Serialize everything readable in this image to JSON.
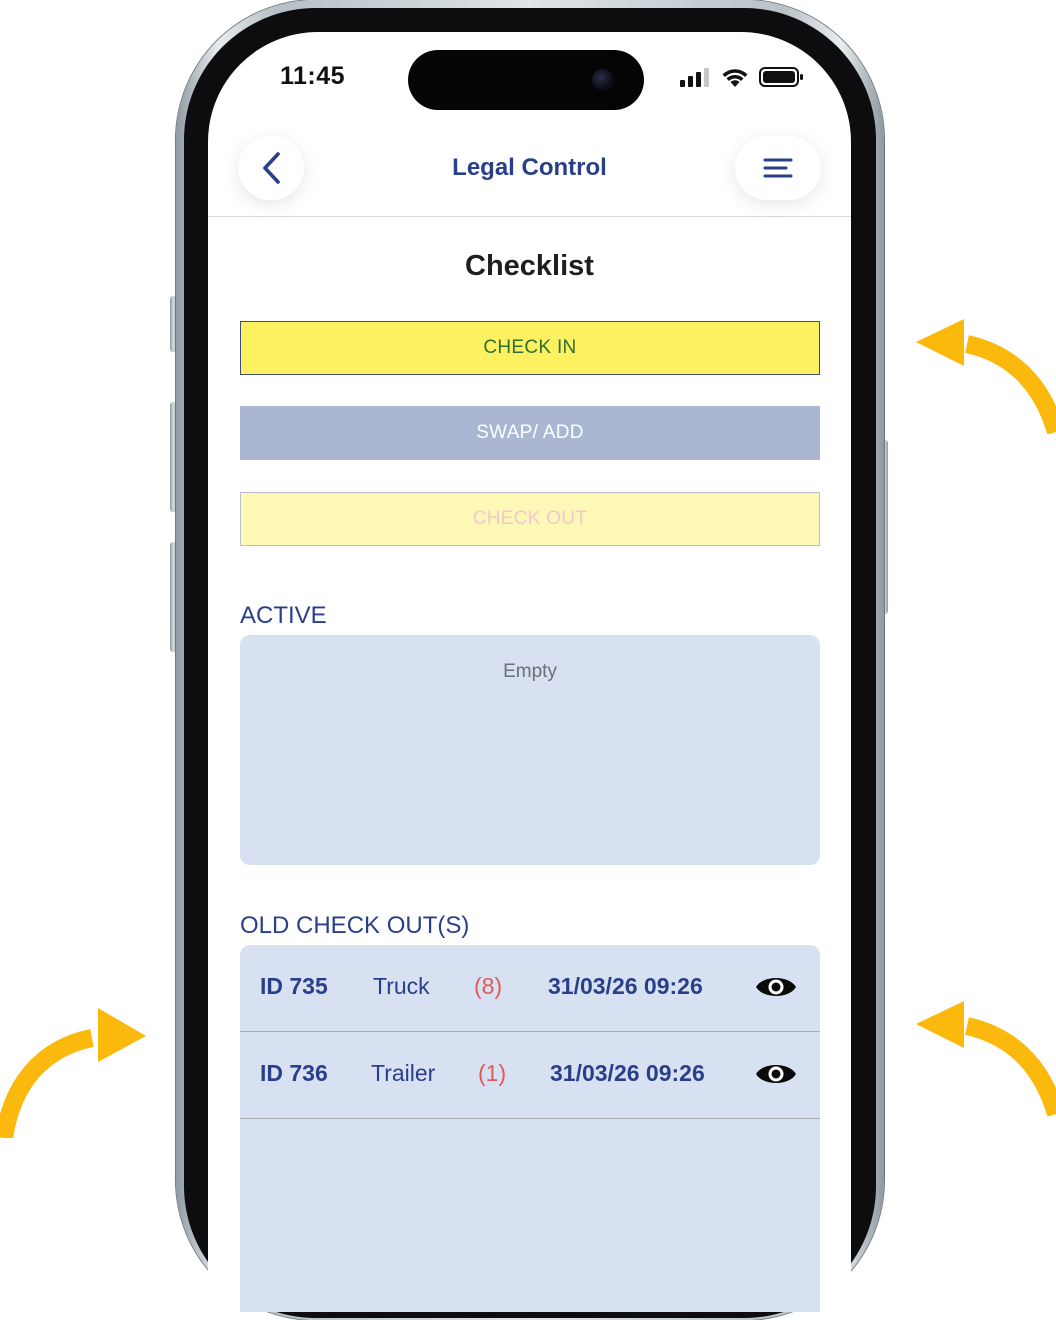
{
  "status_bar": {
    "time": "11:45"
  },
  "header": {
    "title": "Legal Control",
    "back_icon": "chevron-left-icon",
    "menu_icon": "menu-icon"
  },
  "page": {
    "title": "Checklist"
  },
  "actions": {
    "check_in": "CHECK IN",
    "swap_add": "SWAP/ ADD",
    "check_out": "CHECK OUT"
  },
  "active": {
    "label": "ACTIVE",
    "empty_text": "Empty"
  },
  "old_checkouts": {
    "label": "OLD CHECK OUT(S)",
    "rows": [
      {
        "id": "ID 735",
        "type": "Truck",
        "count": "(8)",
        "datetime": "31/03/26 09:26",
        "action_icon": "eye-icon"
      },
      {
        "id": "ID 736",
        "type": "Trailer",
        "count": "(1)",
        "datetime": "31/03/26 09:26",
        "action_icon": "eye-icon"
      }
    ]
  },
  "colors": {
    "accent": "#2a3f8a",
    "check_in_bg": "#fdf061",
    "swap_bg": "#aab6d2",
    "check_out_bg": "#fef8b7",
    "panel_bg": "#d8e1f1",
    "count_red": "#e05a5a",
    "arrow_yellow": "#fbb90d"
  }
}
